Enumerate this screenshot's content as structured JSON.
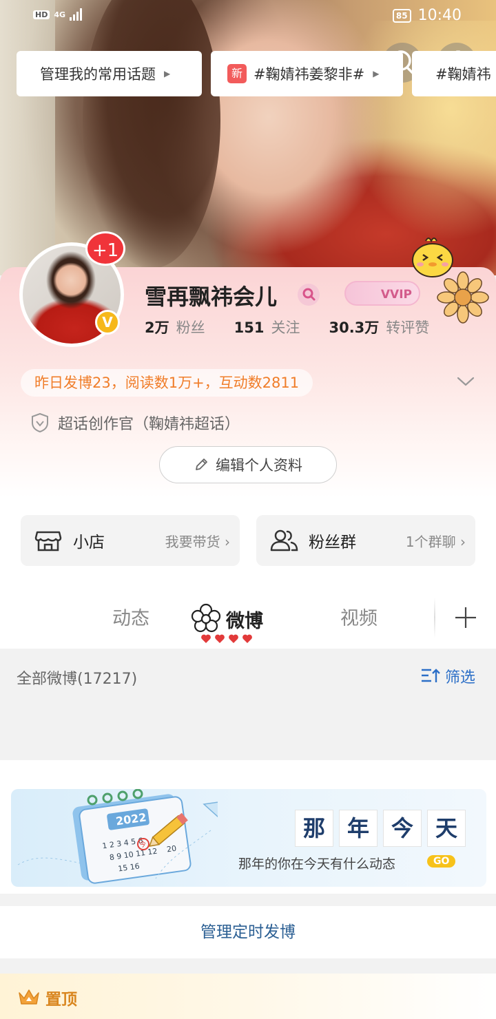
{
  "status_bar": {
    "hd": "HD",
    "network": "4G",
    "battery": "85",
    "time": "10:40"
  },
  "profile": {
    "username": "雪再飘祎会儿",
    "vip_label": "VVIP",
    "plus_badge": "+1",
    "verified_mark": "V",
    "stats": [
      {
        "num": "2万",
        "label": "粉丝"
      },
      {
        "num": "151",
        "label": "关注"
      },
      {
        "num": "30.3万",
        "label": "转评赞"
      }
    ],
    "yesterday_summary": "昨日发博23，阅读数1万+，互动数2811",
    "title": "超话创作官（鞠婧祎超话）",
    "edit_button": "编辑个人资料"
  },
  "cards": {
    "shop": {
      "label": "小店",
      "sub": "我要带货"
    },
    "fans_group": {
      "label": "粉丝群",
      "sub": "1个群聊"
    }
  },
  "tabs": [
    {
      "label": "动态"
    },
    {
      "label": "微博",
      "active": true
    },
    {
      "label": "视频"
    }
  ],
  "weibo_list": {
    "all_label": "全部微博(17217)",
    "filter_label": "筛选",
    "topics": [
      {
        "label": "管理我的常用话题"
      },
      {
        "label": "#鞠婧祎姜黎非#",
        "tag": "新"
      },
      {
        "label": "#鞠婧祎"
      }
    ]
  },
  "banner": {
    "title_chars": [
      "那",
      "年",
      "今",
      "天"
    ],
    "subtitle": "那年的你在今天有什么动态",
    "go": "GO",
    "calendar_year": "2022",
    "calendar_rows": [
      "1 2 3 4 5 6",
      "8 9 10 11 12",
      "15 16",
      "20"
    ],
    "calendar_today": "今"
  },
  "schedule_label": "管理定时发博",
  "pinned_label": "置顶",
  "colors": {
    "accent_orange": "#f07d29",
    "link_blue": "#2c6fc7",
    "badge_red": "#f0343a"
  }
}
